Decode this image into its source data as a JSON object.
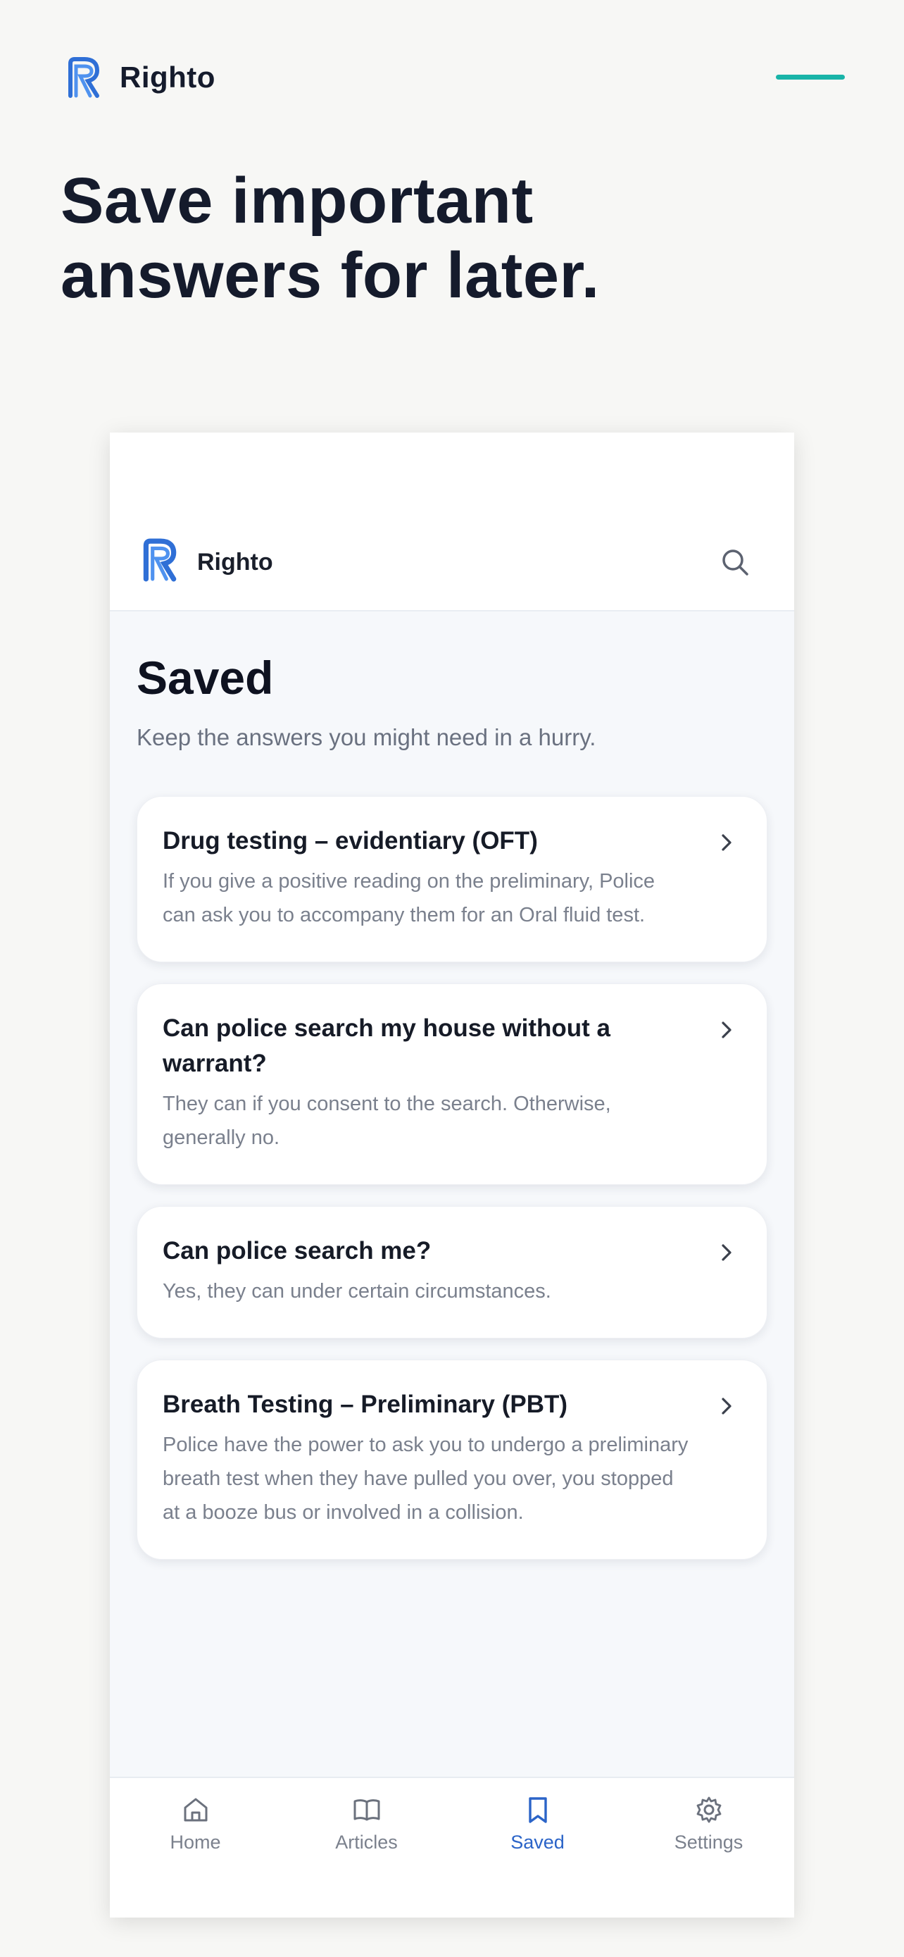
{
  "brand": {
    "name": "Righto"
  },
  "headline": "Save important answers for later.",
  "app": {
    "header_name": "Righto",
    "page_title": "Saved",
    "page_subtitle": "Keep the answers you might need in a hurry.",
    "cards": [
      {
        "title": "Drug testing – evidentiary (OFT)",
        "description": "If you give a positive reading on the preliminary, Police can ask you to accompany them for an Oral fluid test."
      },
      {
        "title": "Can police search my house without a warrant?",
        "description": "They can if you consent to the search. Otherwise, generally no."
      },
      {
        "title": "Can police search me?",
        "description": "Yes, they can under certain circumstances."
      },
      {
        "title": "Breath Testing – Preliminary (PBT)",
        "description": "Police have the power to ask you to undergo a preliminary breath test when they have pulled you over, you stopped at a booze bus or involved in a collision."
      }
    ],
    "nav": [
      {
        "label": "Home",
        "icon": "home-icon"
      },
      {
        "label": "Articles",
        "icon": "book-icon"
      },
      {
        "label": "Saved",
        "icon": "bookmark-icon",
        "active": true
      },
      {
        "label": "Settings",
        "icon": "gear-icon"
      }
    ]
  },
  "colors": {
    "accent": "#19b4a8",
    "primary": "#2b64c8",
    "text_dark": "#151b2c"
  }
}
